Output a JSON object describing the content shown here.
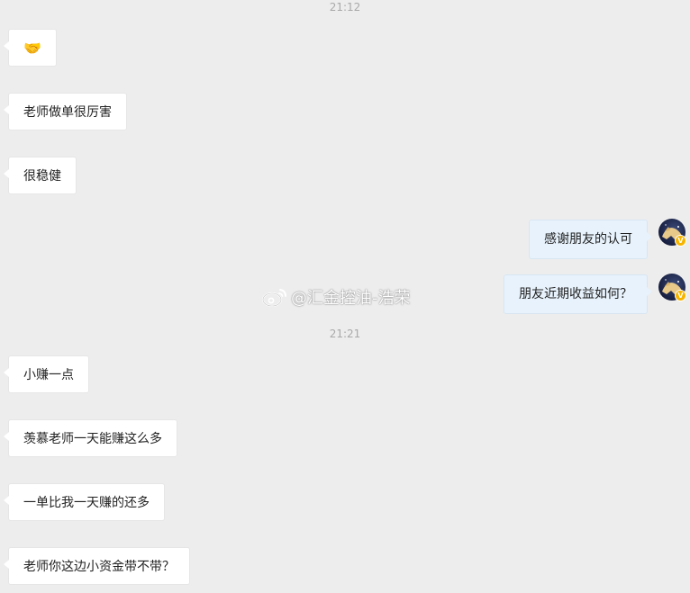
{
  "timestamps": [
    "21:12",
    "21:21"
  ],
  "messages_top": [
    {
      "text": "🤝"
    },
    {
      "text": "老师做单很厉害"
    },
    {
      "text": "很稳健"
    }
  ],
  "messages_out": [
    {
      "text": "感谢朋友的认可"
    },
    {
      "text": "朋友近期收益如何？"
    }
  ],
  "messages_bottom": [
    {
      "text": "小赚一点"
    },
    {
      "text": "羡慕老师一天能赚这么多"
    },
    {
      "text": "一单比我一天赚的还多"
    },
    {
      "text": "老师你这边小资金带不带？"
    }
  ],
  "watermark": {
    "text": "@汇金控油-浩荣"
  },
  "colors": {
    "background": "#ededed",
    "incoming_bubble": "#ffffff",
    "outgoing_bubble": "#e7f2fc",
    "verified_badge": "#f6b400"
  },
  "icons": {
    "avatar_badge": "verified-v-icon",
    "watermark_logo": "weibo-icon"
  }
}
